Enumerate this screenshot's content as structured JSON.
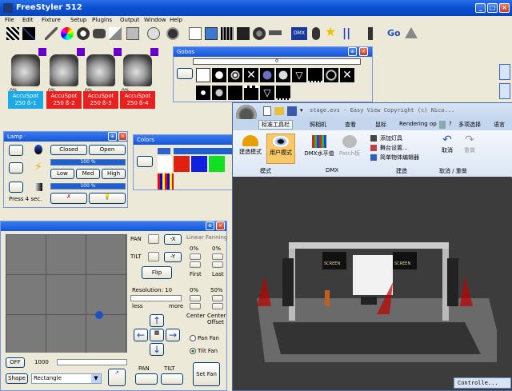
{
  "app": {
    "title": "FreeStyler 512"
  },
  "menu": [
    "File",
    "Edit",
    "Fixture",
    "Setup",
    "Plugins",
    "Output",
    "Window",
    "Help"
  ],
  "toolbar": {
    "dmx_label": "DMX",
    "go_label": "Go"
  },
  "fixtures": [
    {
      "name": "AccuSpot",
      "address": "250 ß-1",
      "pct": "0%",
      "color": "#1ca9e6"
    },
    {
      "name": "AccuSpot",
      "address": "250 ß-2",
      "pct": "0%",
      "color": "#e82020"
    },
    {
      "name": "AccuSpot",
      "address": "250 ß-3",
      "pct": "0%",
      "color": "#e82020"
    },
    {
      "name": "AccuSpot",
      "address": "250 ß-4",
      "pct": "0%",
      "color": "#e82020"
    }
  ],
  "gobos": {
    "title": "Gobos",
    "value": "0"
  },
  "lamp": {
    "title": "Lamp",
    "closed": "Closed",
    "open": "Open",
    "pct1": "100 %",
    "low": "Low",
    "med": "Med",
    "high": "High",
    "pct2": "100 %",
    "press": "Press 4 sec."
  },
  "colors": {
    "title": "Colors"
  },
  "pantilt": {
    "pan": "PAN",
    "tilt": "TILT",
    "neg_x": "-X",
    "neg_y": "-Y",
    "flip": "Flip",
    "resolution": "Resolution: 10",
    "less": "less",
    "more": "more",
    "linear_fanning": "Linear Fanning",
    "first_pct": "0%",
    "last_pct": "0%",
    "first": "First",
    "last": "Last",
    "center_pct": "0%",
    "center_offset_pct": "50%",
    "center": "Center",
    "center_offset": "Center Offset",
    "pan_fan": "Pan Fan",
    "tilt_fan": "Tilt Fan",
    "set_fan": "Set Fan",
    "off": "OFF",
    "value": "1000",
    "shape": "Shape",
    "shape_value": "Rectangle",
    "pan_btn": "PAN",
    "tilt_btn": "TILT"
  },
  "easyview": {
    "title": "stage.evs - Easy View   Copyright (c) Nico...",
    "tabs": [
      "标准工具栏",
      "照相机",
      "查看",
      "鼠标",
      "Rendering op"
    ],
    "help": "?",
    "multi_select": "多项选择",
    "language": "语言",
    "groups": {
      "mode": "模式",
      "dmx": "DMX",
      "build": "建造",
      "undo": "取消 / 重做"
    },
    "build_mode": "建造模式",
    "user_mode": "用户模式",
    "dmx_level": "DMX水平值",
    "patch": "Patch板",
    "add_light": "添加灯具",
    "stage_setup": "舞台设置...",
    "simple_editor": "简单物体编辑器",
    "cancel": "取消",
    "redo": "重做",
    "screen_label": "SCREEN",
    "status": "Controlle..."
  }
}
